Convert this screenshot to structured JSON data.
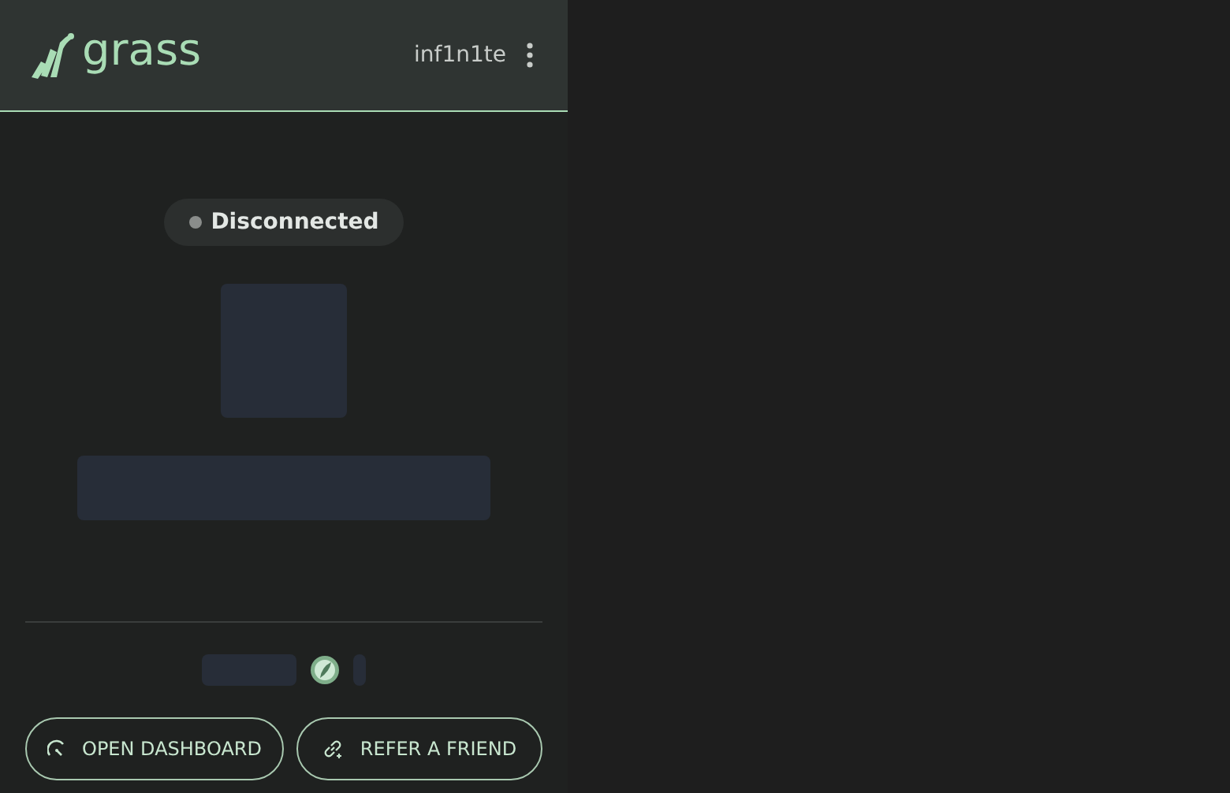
{
  "header": {
    "brand": "grass",
    "username": "inf1n1te"
  },
  "status": {
    "label": "Disconnected",
    "connected": false
  },
  "buttons": [
    {
      "label": "OPEN DASHBOARD",
      "kind": "dashboard"
    },
    {
      "label": "REFER A FRIEND",
      "kind": "refer"
    }
  ]
}
